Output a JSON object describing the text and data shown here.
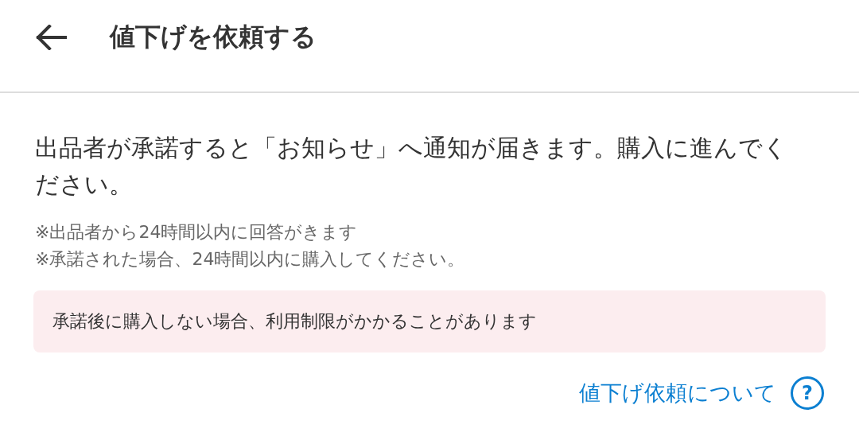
{
  "header": {
    "title": "値下げを依頼する"
  },
  "message": "出品者が承諾すると「お知らせ」へ通知が届きます。購入に進んでください。",
  "notes": [
    "※出品者から24時間以内に回答がきます",
    "※承諾された場合、24時間以内に購入してください。"
  ],
  "warning": "承諾後に購入しない場合、利用制限がかかることがあります",
  "help_link": {
    "label": "値下げ依頼について",
    "icon": "?"
  }
}
